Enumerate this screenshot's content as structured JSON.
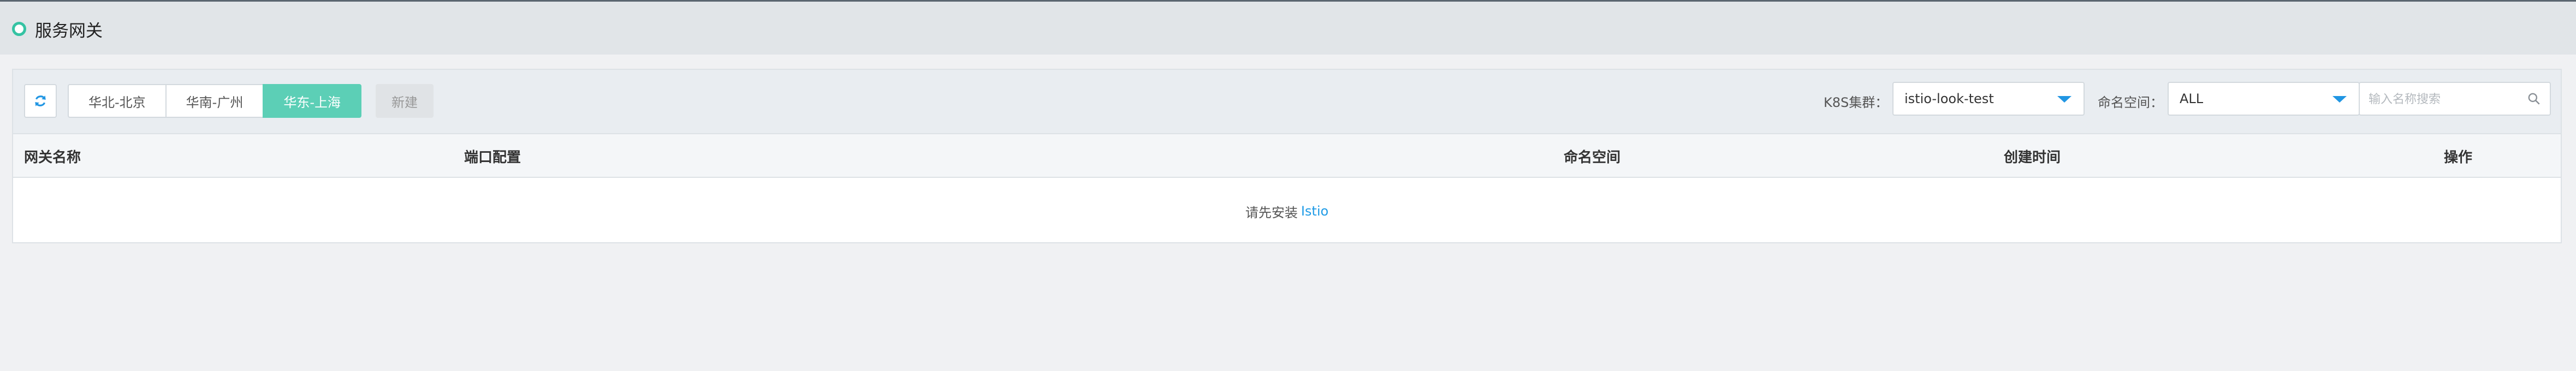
{
  "header": {
    "title": "服务网关"
  },
  "toolbar": {
    "regions": [
      {
        "label": "华北-北京",
        "active": false
      },
      {
        "label": "华南-广州",
        "active": false
      },
      {
        "label": "华东-上海",
        "active": true
      }
    ],
    "new_label": "新建",
    "cluster_label": "K8S集群：",
    "cluster_value": "istio-look-test",
    "namespace_label": "命名空间：",
    "namespace_value": "ALL",
    "search_placeholder": "输入名称搜索"
  },
  "table": {
    "columns": [
      "网关名称",
      "端口配置",
      "命名空间",
      "创建时间",
      "操作"
    ],
    "empty_text": "请先安装",
    "empty_link": "Istio"
  },
  "colors": {
    "accent": "#5ccfb6",
    "link": "#1f9be6",
    "status_dot": "#35c3a3"
  }
}
